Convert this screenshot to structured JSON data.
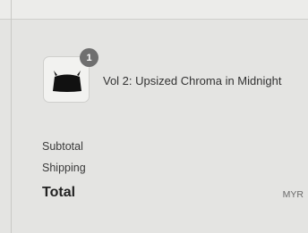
{
  "order_summary": {
    "item": {
      "name": "Vol 2: Upsized Chroma in Midnight",
      "quantity": "1",
      "thumbnail_icon": "bag-icon",
      "thumbnail_color": "#111111"
    },
    "subtotal_label": "Subtotal",
    "shipping_label": "Shipping",
    "total_label": "Total",
    "currency": "MYR"
  }
}
